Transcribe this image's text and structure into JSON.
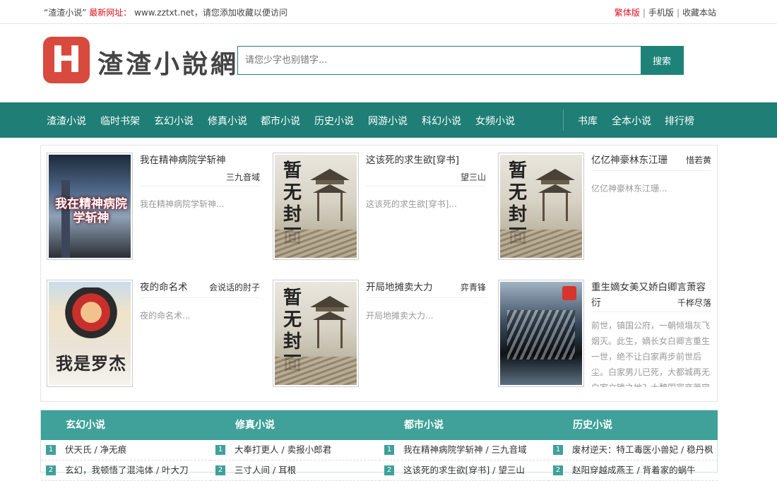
{
  "topbar": {
    "site_quote": "“渣渣小说”",
    "new_url_label": "最新网址：",
    "url_text": "www.zztxt.net，请您添加收藏以便访问",
    "links": [
      "繁体版",
      "手机版",
      "收藏本站"
    ],
    "separator": "|"
  },
  "header": {
    "logo_letter": "H",
    "logo_text": "渣渣小說網",
    "search_placeholder": "请您少字也别错字...",
    "search_button": "搜索"
  },
  "nav": {
    "left": [
      "渣渣小说",
      "临时书架",
      "玄幻小说",
      "修真小说",
      "都市小说",
      "历史小说",
      "网游小说",
      "科幻小说",
      "女频小说"
    ],
    "right": [
      "书库",
      "全本小说",
      "排行榜"
    ]
  },
  "featured": [
    {
      "title": "我在精神病院学斩神",
      "author": "三九音域",
      "desc": "我在精神病院学斩神..."
    },
    {
      "title": "这该死的求生欲[穿书]",
      "author": "望三山",
      "desc": "这该死的求生欲[穿书]..."
    },
    {
      "title": "亿亿神豪林东江珊",
      "author": "惜若黄",
      "desc": "亿亿神豪林东江珊..."
    },
    {
      "title": "夜的命名术",
      "author": "会说话的肘子",
      "desc": "夜的命名术..."
    },
    {
      "title": "开局地摊卖大力",
      "author": "弈青锋",
      "desc": "开局地摊卖大力..."
    },
    {
      "title": "重生嫡女美又娇白卿言萧容衍",
      "author": "千桦尽落",
      "desc": "前世，镇国公府，一朝倾塌灰飞烟灭。此生，嫡长女白卿言重生一世，绝不让白家再步前世后尘。白家男儿已死，大都城再无白家立锥之地？大魏国富商萧容"
    }
  ],
  "covers": {
    "placeholder_text": [
      "暂",
      "无",
      "封",
      "面"
    ],
    "book1_text": "我在精神病院学斩神",
    "book4_text": "我是罗杰"
  },
  "categories": [
    {
      "name": "玄幻小说",
      "rows": [
        {
          "n": "1",
          "text": "伏天氏 / 净无痕"
        },
        {
          "n": "2",
          "text": "玄幻，我顿悟了混沌体 / 叶大刀"
        }
      ]
    },
    {
      "name": "修真小说",
      "rows": [
        {
          "n": "1",
          "text": "大奉打更人 / 卖报小郎君"
        },
        {
          "n": "2",
          "text": "三寸人间 / 耳根"
        }
      ]
    },
    {
      "name": "都市小说",
      "rows": [
        {
          "n": "1",
          "text": "我在精神病院学斩神 / 三九音域"
        },
        {
          "n": "2",
          "text": "这该死的求生欲[穿书] / 望三山"
        }
      ]
    },
    {
      "name": "历史小说",
      "rows": [
        {
          "n": "1",
          "text": "废材逆天：特工毒医小兽妃 / 稳丹枫"
        },
        {
          "n": "2",
          "text": "赵阳穿越成燕王 / 背着家的蜗牛"
        }
      ]
    }
  ],
  "colors": {
    "accent": "#1f7e75",
    "category_header": "#3fa199",
    "logo": "#d84a3e",
    "highlight_red": "#dd1122"
  }
}
